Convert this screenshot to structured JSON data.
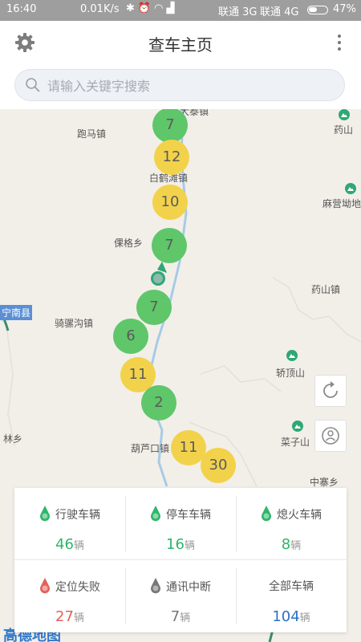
{
  "status_bar": {
    "time": "16:40",
    "speed": "0.01K/s",
    "carrier1": "联通 3G",
    "carrier2": "联通 4G",
    "battery": "47%"
  },
  "header": {
    "title": "查车主页",
    "settings_icon": "gear-icon",
    "more_icon": "more-vertical-icon"
  },
  "search": {
    "placeholder": "请输入关键字搜索",
    "value": ""
  },
  "map": {
    "places": [
      "大泰镇",
      "跑马镇",
      "白鹤滩镇",
      "倮格乡",
      "药山镇",
      "骑骡沟镇",
      "葫芦口镇",
      "中寨乡",
      "林乡"
    ],
    "county_label": "宁南县",
    "mountains": [
      "药山",
      "麻营坳地",
      "轿顶山",
      "菜子山"
    ],
    "clusters": [
      "7",
      "12",
      "10",
      "7",
      "7",
      "6",
      "11",
      "2",
      "11",
      "30"
    ],
    "watermark": "高德地图",
    "buttons": [
      "refresh-icon",
      "locate-user-icon"
    ]
  },
  "summary": {
    "driving": {
      "label": "行驶车辆",
      "value": "46",
      "unit": "辆",
      "color": "#2db56a"
    },
    "parked": {
      "label": "停车车辆",
      "value": "16",
      "unit": "辆",
      "color": "#2db56a"
    },
    "engine_off": {
      "label": "熄火车辆",
      "value": "8",
      "unit": "辆",
      "color": "#2db56a"
    },
    "location_failed": {
      "label": "定位失败",
      "value": "27",
      "unit": "辆",
      "color": "#e2605a"
    },
    "comm_lost": {
      "label": "通讯中断",
      "value": "7",
      "unit": "辆",
      "color": "#777777"
    },
    "all": {
      "label": "全部车辆",
      "value": "104",
      "unit": "辆",
      "color": "#2d6fc1"
    }
  }
}
